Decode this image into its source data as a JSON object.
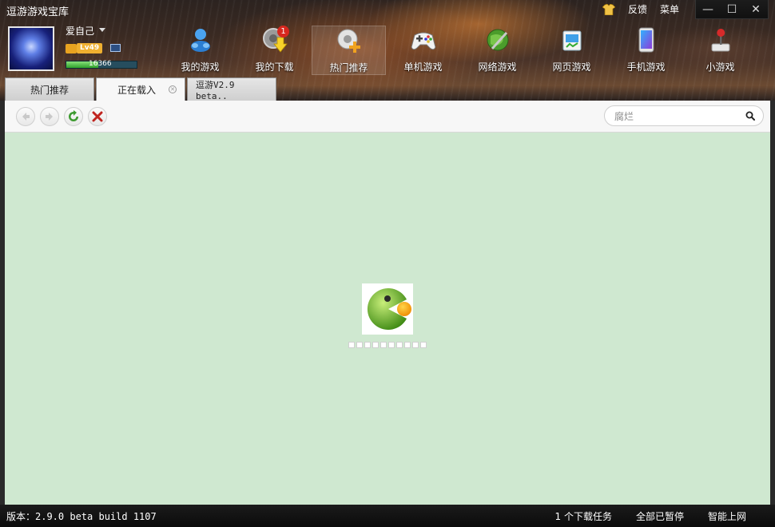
{
  "app": {
    "title": "逗游游戏宝库"
  },
  "top_links": {
    "feedback": "反馈",
    "menu": "菜单"
  },
  "window_controls": {
    "minimize": "—",
    "maximize": "☐",
    "close": "✕"
  },
  "profile": {
    "username": "爱自己",
    "level": "Lv49",
    "exp_value": "16366",
    "exp_progress": 0.45
  },
  "nav": {
    "items": [
      {
        "label": "我的游戏",
        "icon": "my-games-icon",
        "badge": ""
      },
      {
        "label": "我的下载",
        "icon": "download-icon",
        "badge": "1"
      },
      {
        "label": "热门推荐",
        "icon": "hot-icon",
        "badge": ""
      },
      {
        "label": "单机游戏",
        "icon": "gamepad-icon",
        "badge": ""
      },
      {
        "label": "网络游戏",
        "icon": "network-icon",
        "badge": ""
      },
      {
        "label": "网页游戏",
        "icon": "web-icon",
        "badge": ""
      },
      {
        "label": "手机游戏",
        "icon": "phone-icon",
        "badge": ""
      },
      {
        "label": "小游戏",
        "icon": "joystick-icon",
        "badge": ""
      }
    ]
  },
  "tabs": [
    {
      "label": "热门推荐"
    },
    {
      "label": "正在载入"
    },
    {
      "label": "逗游V2.9 beta.."
    }
  ],
  "toolbar": {
    "search_placeholder": "腐烂"
  },
  "statusbar": {
    "version": "版本：2.9.0 beta build 1107",
    "downloads": "1 个下载任务",
    "pause_all": "全部已暂停",
    "smart_online": "智能上网"
  },
  "colors": {
    "content_bg": "#cfe8d0",
    "badge_red": "#d7271e",
    "accent_green": "#8cc63f"
  }
}
